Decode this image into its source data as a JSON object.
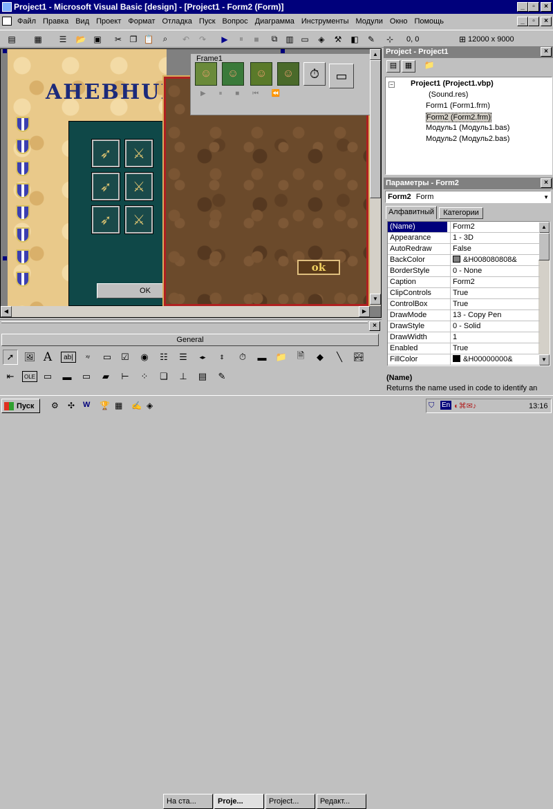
{
  "window": {
    "title": "Project1 - Microsoft Visual Basic [design] - [Project1 - Form2 (Form)]"
  },
  "menu": [
    "Файл",
    "Правка",
    "Вид",
    "Проект",
    "Формат",
    "Отладка",
    "Пуск",
    "Вопрос",
    "Диаграмма",
    "Инструменты",
    "Модули",
    "Окно",
    "Помощь"
  ],
  "toolbar": {
    "position": "0, 0",
    "size": "12000 x 9000"
  },
  "form": {
    "heading": "AHEBHUK",
    "frame_caption": "Frame1",
    "ok_button": "ok",
    "ok_small_button": "OK"
  },
  "project": {
    "title": "Project - Project1",
    "root": "Project1 (Project1.vbp)",
    "items": [
      "(Sound.res)",
      "Form1 (Form1.frm)",
      "Form2 (Form2.frm)",
      "Модуль1 (Модуль1.bas)",
      "Модуль2 (Модуль2.bas)"
    ]
  },
  "properties": {
    "title": "Параметры - Form2",
    "object_name": "Form2",
    "object_type": "Form",
    "tabs": [
      "Алфавитный",
      "Категории"
    ],
    "rows": [
      {
        "k": "(Name)",
        "v": "Form2"
      },
      {
        "k": "Appearance",
        "v": "1 - 3D"
      },
      {
        "k": "AutoRedraw",
        "v": "False"
      },
      {
        "k": "BackColor",
        "v": "&H008080808&",
        "color": "#808080"
      },
      {
        "k": "BorderStyle",
        "v": "0 - None"
      },
      {
        "k": "Caption",
        "v": "Form2"
      },
      {
        "k": "ClipControls",
        "v": "True"
      },
      {
        "k": "ControlBox",
        "v": "True"
      },
      {
        "k": "DrawMode",
        "v": "13 - Copy Pen"
      },
      {
        "k": "DrawStyle",
        "v": "0 - Solid"
      },
      {
        "k": "DrawWidth",
        "v": "1"
      },
      {
        "k": "Enabled",
        "v": "True"
      },
      {
        "k": "FillColor",
        "v": "&H00000000&",
        "color": "#000000"
      }
    ],
    "desc_title": "(Name)",
    "desc_text": "Returns the name used in code to identify an"
  },
  "toolbox": {
    "tab": "General"
  },
  "taskbar": {
    "start": "Пуск",
    "tasks": [
      "На ста...",
      "Proje...",
      "Project...",
      "Редакт..."
    ],
    "lang": "En",
    "time": "13:16"
  }
}
